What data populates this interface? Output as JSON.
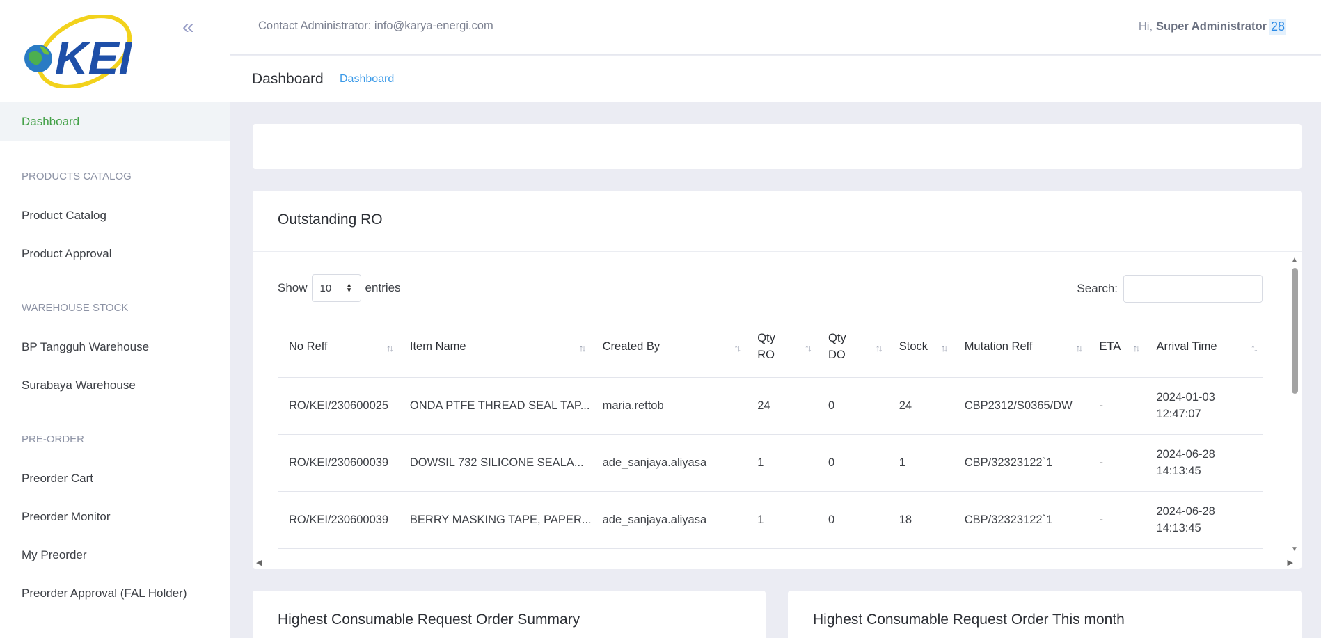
{
  "brand": {
    "logo_text": "KEI"
  },
  "sidebar": {
    "active": {
      "label": "Dashboard"
    },
    "sections": [
      {
        "title": "PRODUCTS CATALOG",
        "items": [
          "Product Catalog",
          "Product Approval"
        ]
      },
      {
        "title": "WAREHOUSE STOCK",
        "items": [
          "BP Tangguh Warehouse",
          "Surabaya Warehouse"
        ]
      },
      {
        "title": "PRE-ORDER",
        "items": [
          "Preorder Cart",
          "Preorder Monitor",
          "My Preorder",
          "Preorder Approval (FAL Holder)"
        ]
      }
    ]
  },
  "topbar": {
    "contact": "Contact Administrator: info@karya-energi.com",
    "greeting": "Hi,",
    "user": "Super Administrator",
    "badge": "28"
  },
  "subheader": {
    "title": "Dashboard",
    "breadcrumb": "Dashboard"
  },
  "outstanding": {
    "title": "Outstanding RO",
    "show_label": "Show",
    "entries_value": "10",
    "entries_label": "entries",
    "search_label": "Search:",
    "columns": [
      {
        "line1": "No Reff",
        "line2": ""
      },
      {
        "line1": "Item Name",
        "line2": ""
      },
      {
        "line1": "Created By",
        "line2": ""
      },
      {
        "line1": "Qty",
        "line2": "RO"
      },
      {
        "line1": "Qty",
        "line2": "DO"
      },
      {
        "line1": "Stock",
        "line2": ""
      },
      {
        "line1": "Mutation Reff",
        "line2": ""
      },
      {
        "line1": "ETA",
        "line2": ""
      },
      {
        "line1": "Arrival Time",
        "line2": ""
      }
    ],
    "rows": [
      {
        "no_reff": "RO/KEI/230600025",
        "item": "ONDA PTFE THREAD SEAL TAP...",
        "created_by": "maria.rettob",
        "qty_ro": "24",
        "qty_do": "0",
        "stock": "24",
        "mutation": "CBP2312/S0365/DW",
        "eta": "-",
        "arrival_date": "2024-01-03",
        "arrival_time": "12:47:07"
      },
      {
        "no_reff": "RO/KEI/230600039",
        "item": "DOWSIL 732 SILICONE SEALA...",
        "created_by": "ade_sanjaya.aliyasa",
        "qty_ro": "1",
        "qty_do": "0",
        "stock": "1",
        "mutation": "CBP/32323122`1",
        "eta": "-",
        "arrival_date": "2024-06-28",
        "arrival_time": "14:13:45"
      },
      {
        "no_reff": "RO/KEI/230600039",
        "item": "BERRY MASKING TAPE, PAPER...",
        "created_by": "ade_sanjaya.aliyasa",
        "qty_ro": "1",
        "qty_do": "0",
        "stock": "18",
        "mutation": "CBP/32323122`1",
        "eta": "-",
        "arrival_date": "2024-06-28",
        "arrival_time": "14:13:45"
      }
    ]
  },
  "cards": {
    "left_title": "Highest Consumable Request Order Summary",
    "right_title": "Highest Consumable Request Order This month"
  }
}
